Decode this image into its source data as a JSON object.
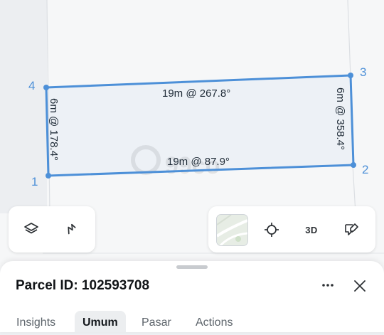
{
  "map": {
    "vertices": [
      {
        "label": "1"
      },
      {
        "label": "2"
      },
      {
        "label": "3"
      },
      {
        "label": "4"
      }
    ],
    "edges": {
      "top": "19m @ 267.8°",
      "bottom": "19m @ 87.9°",
      "left": "6m @ 178.4°",
      "right": "6m @ 358.4°"
    },
    "parcel_color": "#4d90d8"
  },
  "controls": {
    "left": [
      {
        "icon": "layers-icon"
      },
      {
        "icon": "measure-icon"
      }
    ],
    "right": [
      {
        "icon": "satellite-thumbnail"
      },
      {
        "icon": "locate-icon"
      },
      {
        "label": "3D"
      },
      {
        "icon": "feedback-icon"
      }
    ]
  },
  "sheet": {
    "title": "Parcel ID: 102593708",
    "tabs": [
      "Insights",
      "Umum",
      "Pasar",
      "Actions"
    ],
    "active_tab": "Umum"
  }
}
